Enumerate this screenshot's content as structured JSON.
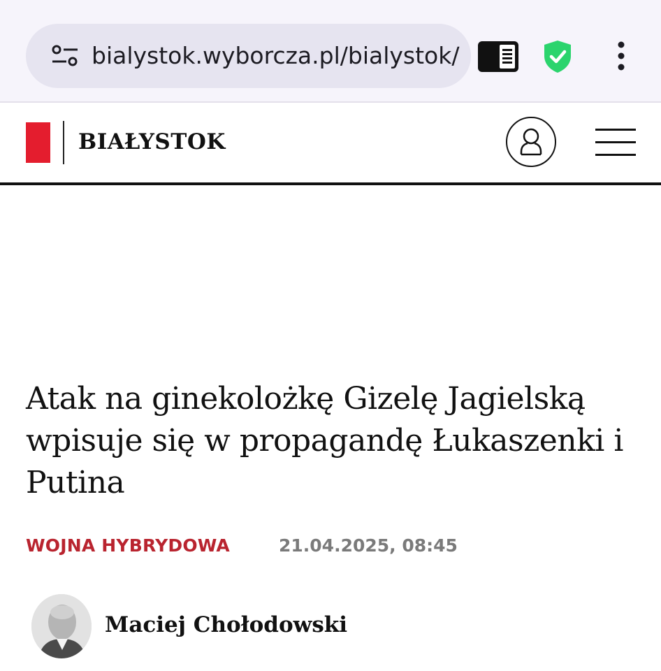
{
  "browser": {
    "url": "bialystok.wyborcza.pl/bialystok/",
    "icons": {
      "site_settings": "tune-icon",
      "reader_mode": "reader-view-icon",
      "security": "shield-check-icon",
      "menu": "more-vert-icon"
    },
    "shield_color": "#2bd46d"
  },
  "site": {
    "section": "BIAŁYSTOK",
    "logo_color": "#e41d2e",
    "icons": {
      "account": "user-icon",
      "menu": "hamburger-icon"
    }
  },
  "article": {
    "headline": "Atak na ginekolożkę Gizelę Jagielską wpisuje się w propagandę Łukaszenki i Putina",
    "category": "WOJNA HYBRYDOWA",
    "category_color": "#b9242f",
    "date": "21.04.2025, 08:45",
    "author": "Maciej Chołodowski"
  }
}
